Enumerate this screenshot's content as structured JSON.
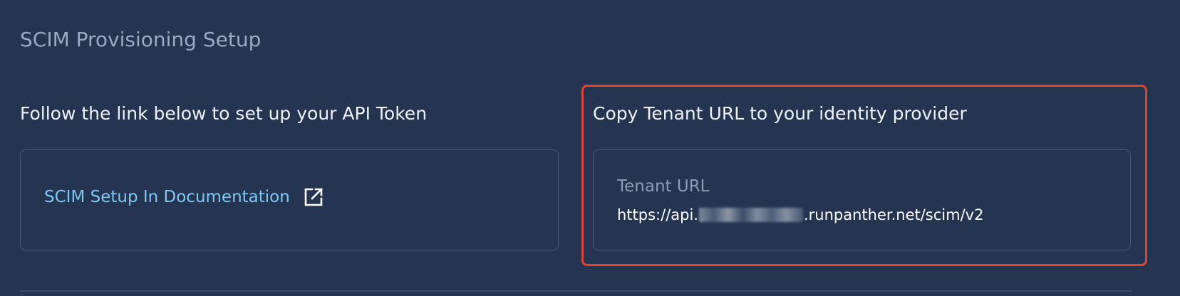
{
  "page": {
    "title": "SCIM Provisioning Setup"
  },
  "api_token_section": {
    "heading": "Follow the link below to set up your API Token",
    "link_label": "SCIM Setup In Documentation",
    "link_icon": "external-link-icon"
  },
  "tenant_section": {
    "heading": "Copy Tenant URL to your identity provider",
    "field_label": "Tenant URL",
    "url_prefix": "https://api.",
    "url_suffix": ".runpanther.net/scim/v2",
    "highlight_color": "#e0442c"
  },
  "colors": {
    "background": "#243451",
    "link": "#7ec7f2",
    "card_border": "#475a78"
  }
}
